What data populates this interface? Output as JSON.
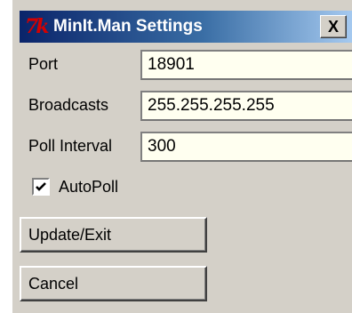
{
  "window": {
    "title": "MinIt.Man Settings",
    "icon_text": "7k",
    "close_label": "X"
  },
  "form": {
    "port": {
      "label": "Port",
      "value": "18901"
    },
    "broadcasts": {
      "label": "Broadcasts",
      "value": "255.255.255.255"
    },
    "poll_interval": {
      "label": "Poll Interval",
      "value": "300"
    }
  },
  "autopoll": {
    "label": "AutoPoll",
    "checked": true
  },
  "buttons": {
    "update_exit": "Update/Exit",
    "cancel": "Cancel"
  },
  "colors": {
    "titlebar_start": "#0a246a",
    "titlebar_end": "#a6caf0",
    "dialog_face": "#d4d0c8",
    "field_background": "#fffff0",
    "tk_logo": "#d40000"
  },
  "icons": {
    "app": "tk-logo-icon",
    "close": "close-icon",
    "check": "checkmark-icon"
  }
}
